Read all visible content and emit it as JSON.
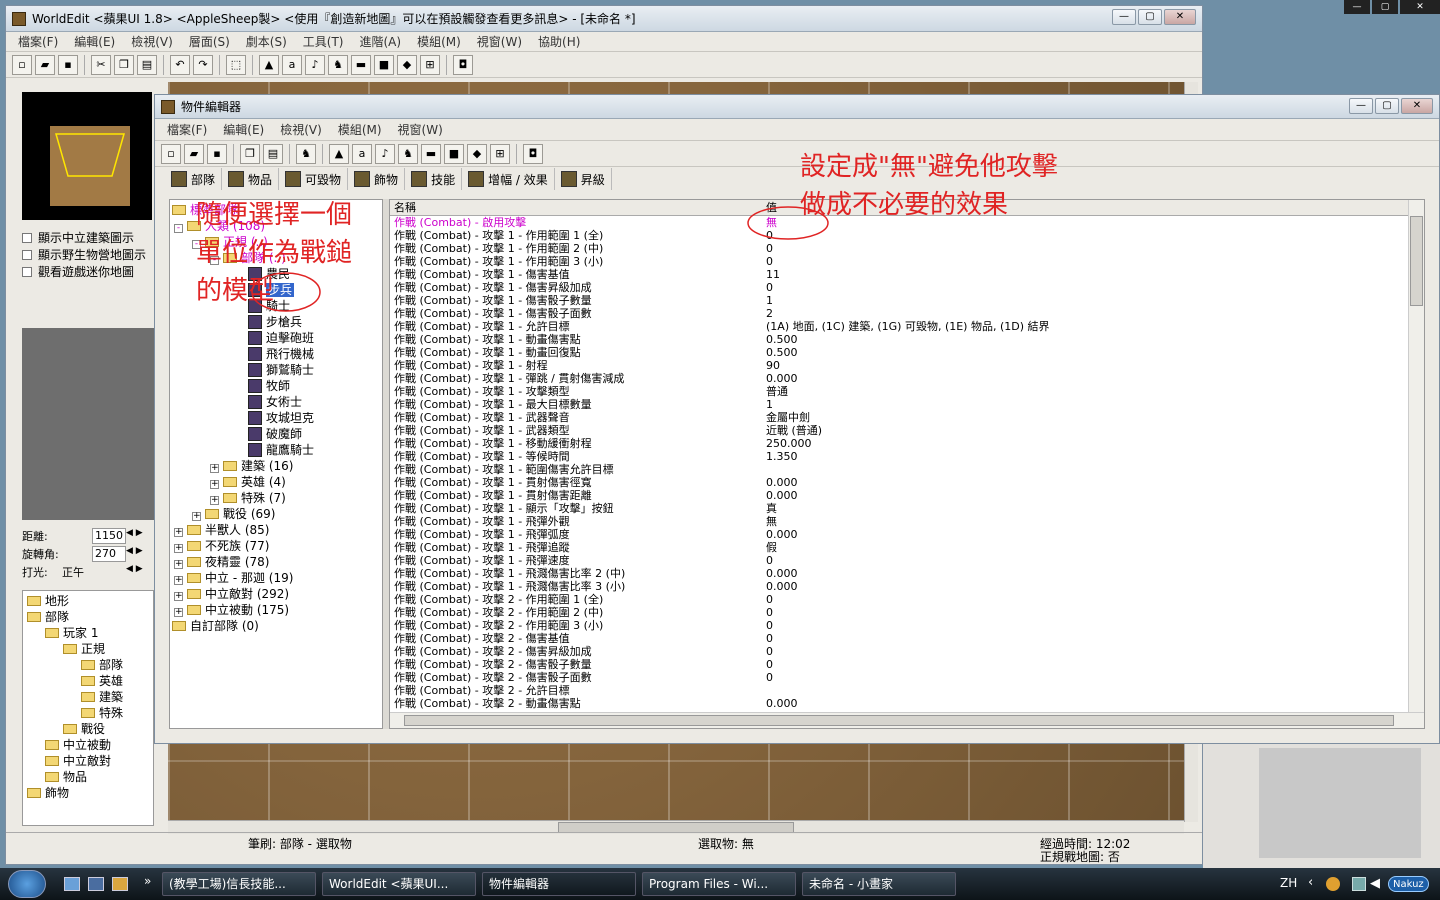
{
  "desktop": {
    "top_right_buttons": [
      "—",
      "▢",
      "✕"
    ]
  },
  "main_window": {
    "title": "WorldEdit <蘋果UI 1.8> <AppleSheep製> <使用『創造新地圖』可以在預設觸發查看更多訊息> - [未命名 *]",
    "menu": [
      "檔案(F)",
      "編輯(E)",
      "檢視(V)",
      "層面(S)",
      "劇本(S)",
      "工具(T)",
      "進階(A)",
      "模組(M)",
      "視窗(W)",
      "協助(H)"
    ],
    "checkboxes": [
      "顯示中立建築圖示",
      "顯示野生物營地圖示",
      "觀看遊戲迷你地圖"
    ],
    "camera": {
      "distance_label": "距離:",
      "distance_value": "1150",
      "rotation_label": "旋轉角:",
      "rotation_value": "270",
      "light_label": "打光:",
      "light_value": "正午"
    },
    "layer_tree": [
      "地形",
      "部隊",
      "玩家 1",
      "正規",
      "部隊",
      "英雄",
      "建築",
      "特殊",
      "戰役",
      "中立被動",
      "中立敵對",
      "物品",
      "飾物"
    ],
    "status": {
      "brush": "筆刷: 部隊 - 選取物",
      "selection": "選取物: 無",
      "elapsed": "經過時間: 12:02",
      "melee_map": "正規戰地圖: 否"
    }
  },
  "object_editor": {
    "title": "物件編輯器",
    "menu": [
      "檔案(F)",
      "編輯(E)",
      "檢視(V)",
      "模組(M)",
      "視窗(W)"
    ],
    "tabs": [
      "部隊",
      "物品",
      "可毀物",
      "飾物",
      "技能",
      "增幅 / 效果",
      "昇級"
    ],
    "tree": {
      "root": "標準部隊",
      "human": "人類 (108)",
      "melee": "正規 (..)",
      "units_folder": "部隊 (..)",
      "units": [
        "農民",
        "步兵",
        "騎士",
        "步槍兵",
        "迫擊砲班",
        "飛行機械",
        "獅鷲騎士",
        "牧師",
        "女術士",
        "攻城坦克",
        "破魔師",
        "龍鷹騎士"
      ],
      "sub": [
        "建築 (16)",
        "英雄 (4)",
        "特殊 (7)"
      ],
      "campaign": "戰役 (69)",
      "races": [
        "半獸人 (85)",
        "不死族 (77)",
        "夜精靈 (78)",
        "中立 - 那迦 (19)",
        "中立敵對 (292)",
        "中立被動 (175)"
      ],
      "custom": "自訂部隊 (0)"
    },
    "table": {
      "header_name": "名稱",
      "header_value": "值",
      "rows": [
        [
          "作戰 (Combat) - 啟用攻擊",
          "無"
        ],
        [
          "作戰 (Combat) - 攻擊 1 - 作用範圍 1 (全)",
          "0"
        ],
        [
          "作戰 (Combat) - 攻擊 1 - 作用範圍 2 (中)",
          "0"
        ],
        [
          "作戰 (Combat) - 攻擊 1 - 作用範圍 3 (小)",
          "0"
        ],
        [
          "作戰 (Combat) - 攻擊 1 - 傷害基值",
          "11"
        ],
        [
          "作戰 (Combat) - 攻擊 1 - 傷害昇級加成",
          "0"
        ],
        [
          "作戰 (Combat) - 攻擊 1 - 傷害骰子數量",
          "1"
        ],
        [
          "作戰 (Combat) - 攻擊 1 - 傷害骰子面數",
          "2"
        ],
        [
          "作戰 (Combat) - 攻擊 1 - 允許目標",
          "(1A) 地面, (1C) 建築, (1G) 可毀物, (1E) 物品, (1D) 結界"
        ],
        [
          "作戰 (Combat) - 攻擊 1 - 動畫傷害點",
          "0.500"
        ],
        [
          "作戰 (Combat) - 攻擊 1 - 動畫回復點",
          "0.500"
        ],
        [
          "作戰 (Combat) - 攻擊 1 - 射程",
          "90"
        ],
        [
          "作戰 (Combat) - 攻擊 1 - 彈跳 / 貫射傷害減成",
          "0.000"
        ],
        [
          "作戰 (Combat) - 攻擊 1 - 攻擊類型",
          "普通"
        ],
        [
          "作戰 (Combat) - 攻擊 1 - 最大目標數量",
          "1"
        ],
        [
          "作戰 (Combat) - 攻擊 1 - 武器聲音",
          "金屬中劍"
        ],
        [
          "作戰 (Combat) - 攻擊 1 - 武器類型",
          "近戰 (普通)"
        ],
        [
          "作戰 (Combat) - 攻擊 1 - 移動緩衝射程",
          "250.000"
        ],
        [
          "作戰 (Combat) - 攻擊 1 - 等候時間",
          "1.350"
        ],
        [
          "作戰 (Combat) - 攻擊 1 - 範圍傷害允許目標",
          ""
        ],
        [
          "作戰 (Combat) - 攻擊 1 - 貫射傷害徑寬",
          "0.000"
        ],
        [
          "作戰 (Combat) - 攻擊 1 - 貫射傷害距離",
          "0.000"
        ],
        [
          "作戰 (Combat) - 攻擊 1 - 顯示「攻擊」按鈕",
          "真"
        ],
        [
          "作戰 (Combat) - 攻擊 1 - 飛彈外觀",
          "無"
        ],
        [
          "作戰 (Combat) - 攻擊 1 - 飛彈弧度",
          "0.000"
        ],
        [
          "作戰 (Combat) - 攻擊 1 - 飛彈追蹤",
          "假"
        ],
        [
          "作戰 (Combat) - 攻擊 1 - 飛彈速度",
          "0"
        ],
        [
          "作戰 (Combat) - 攻擊 1 - 飛濺傷害比率 2 (中)",
          "0.000"
        ],
        [
          "作戰 (Combat) - 攻擊 1 - 飛濺傷害比率 3 (小)",
          "0.000"
        ],
        [
          "作戰 (Combat) - 攻擊 2 - 作用範圍 1 (全)",
          "0"
        ],
        [
          "作戰 (Combat) - 攻擊 2 - 作用範圍 2 (中)",
          "0"
        ],
        [
          "作戰 (Combat) - 攻擊 2 - 作用範圍 3 (小)",
          "0"
        ],
        [
          "作戰 (Combat) - 攻擊 2 - 傷害基值",
          "0"
        ],
        [
          "作戰 (Combat) - 攻擊 2 - 傷害昇級加成",
          "0"
        ],
        [
          "作戰 (Combat) - 攻擊 2 - 傷害骰子數量",
          "0"
        ],
        [
          "作戰 (Combat) - 攻擊 2 - 傷害骰子面數",
          "0"
        ],
        [
          "作戰 (Combat) - 攻擊 2 - 允許目標",
          ""
        ],
        [
          "作戰 (Combat) - 攻擊 2 - 動畫傷害點",
          "0.000"
        ]
      ]
    }
  },
  "annotations": {
    "left": "隨便選擇一個\n單位作為戰鎚\n的模型",
    "right": "設定成\"無\"避免他攻擊\n做成不必要的效果"
  },
  "taskbar": {
    "tasks": [
      "(教學工場)信長技能...",
      "WorldEdit <蘋果UI...",
      "物件編輯器",
      "Program Files - Wi...",
      "未命名 - 小畫家"
    ],
    "lang": "ZH",
    "tray_badge": "Nakuz"
  },
  "colors": {
    "accent_red": "#e02424",
    "highlight": "#cc00cc",
    "selection": "#3366cc"
  }
}
